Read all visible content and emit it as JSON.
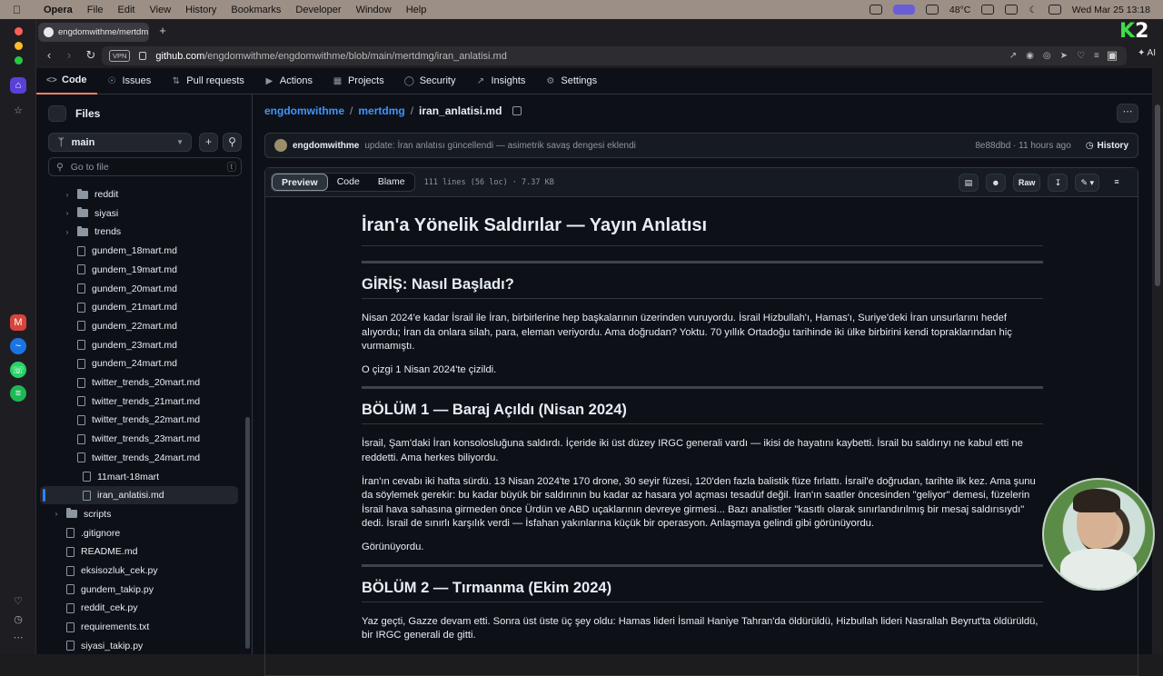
{
  "menubar": {
    "app": "Opera",
    "items": [
      "File",
      "Edit",
      "View",
      "History",
      "Bookmarks",
      "Developer",
      "Window",
      "Help"
    ],
    "temperature": "48°C",
    "datetime": "Wed Mar 25  13:18"
  },
  "browser": {
    "tab_title": "engdomwithme/mertdm",
    "url_host": "github.com",
    "url_path": "/engdomwithme/engdomwithme/blob/main/mertdmg/iran_anlatisi.md",
    "vpn_label": "VPN",
    "ai_label": "AI",
    "logo": "K2"
  },
  "repo_tabs": [
    {
      "icon": "code-icon",
      "label": "Code"
    },
    {
      "icon": "issues-icon",
      "label": "Issues"
    },
    {
      "icon": "pull-request-icon",
      "label": "Pull requests"
    },
    {
      "icon": "actions-icon",
      "label": "Actions"
    },
    {
      "icon": "projects-icon",
      "label": "Projects"
    },
    {
      "icon": "security-icon",
      "label": "Security"
    },
    {
      "icon": "insights-icon",
      "label": "Insights"
    },
    {
      "icon": "settings-icon",
      "label": "Settings"
    }
  ],
  "files": {
    "title": "Files",
    "branch": "main",
    "goto_placeholder": "Go to file",
    "goto_key": "t",
    "tree": [
      {
        "type": "folder",
        "name": "reddit",
        "depth": 1,
        "expandable": true
      },
      {
        "type": "folder",
        "name": "siyasi",
        "depth": 1,
        "expandable": true
      },
      {
        "type": "folder",
        "name": "trends",
        "depth": 1,
        "expandable": true
      },
      {
        "type": "file",
        "name": "gundem_18mart.md",
        "depth": 1
      },
      {
        "type": "file",
        "name": "gundem_19mart.md",
        "depth": 1
      },
      {
        "type": "file",
        "name": "gundem_20mart.md",
        "depth": 1
      },
      {
        "type": "file",
        "name": "gundem_21mart.md",
        "depth": 1
      },
      {
        "type": "file",
        "name": "gundem_22mart.md",
        "depth": 1
      },
      {
        "type": "file",
        "name": "gundem_23mart.md",
        "depth": 1
      },
      {
        "type": "file",
        "name": "gundem_24mart.md",
        "depth": 1
      },
      {
        "type": "file",
        "name": "twitter_trends_20mart.md",
        "depth": 1
      },
      {
        "type": "file",
        "name": "twitter_trends_21mart.md",
        "depth": 1
      },
      {
        "type": "file",
        "name": "twitter_trends_22mart.md",
        "depth": 1
      },
      {
        "type": "file",
        "name": "twitter_trends_23mart.md",
        "depth": 1
      },
      {
        "type": "file",
        "name": "twitter_trends_24mart.md",
        "depth": 1
      },
      {
        "type": "file",
        "name": "11mart-18mart",
        "depth": 0.5
      },
      {
        "type": "file",
        "name": "iran_anlatisi.md",
        "depth": 0.5,
        "selected": true
      },
      {
        "type": "folder",
        "name": "scripts",
        "depth": 0,
        "expandable": true
      },
      {
        "type": "file",
        "name": ".gitignore",
        "depth": 0
      },
      {
        "type": "file",
        "name": "README.md",
        "depth": 0
      },
      {
        "type": "file",
        "name": "eksisozluk_cek.py",
        "depth": 0
      },
      {
        "type": "file",
        "name": "gundem_takip.py",
        "depth": 0
      },
      {
        "type": "file",
        "name": "reddit_cek.py",
        "depth": 0
      },
      {
        "type": "file",
        "name": "requirements.txt",
        "depth": 0
      },
      {
        "type": "file",
        "name": "siyasi_takip.py",
        "depth": 0
      }
    ]
  },
  "breadcrumb": {
    "owner": "engdomwithme",
    "folder": "mertdmg",
    "file": "iran_anlatisi.md"
  },
  "commit": {
    "author": "engdomwithme",
    "message": "update: İran anlatısı güncellendi — asimetrik savaş dengesi eklendi",
    "meta": "8e88dbd · 11 hours ago",
    "history_label": "History"
  },
  "file_header": {
    "tabs": [
      "Preview",
      "Code",
      "Blame"
    ],
    "active_tab": "Preview",
    "info": "111 lines (56 loc) · 7.37 KB",
    "raw_label": "Raw"
  },
  "doc": {
    "title": "İran'a Yönelik Saldırılar — Yayın Anlatısı",
    "h_intro": "GİRİŞ: Nasıl Başladı?",
    "p_intro1": "Nisan 2024'e kadar İsrail ile İran, birbirlerine hep başkalarının üzerinden vuruyordu. İsrail Hizbullah'ı, Hamas'ı, Suriye'deki İran unsurlarını hedef alıyordu; İran da onlara silah, para, eleman veriyordu. Ama doğrudan? Yoktu. 70 yıllık Ortadoğu tarihinde iki ülke birbirini kendi topraklarından hiç vurmamıştı.",
    "p_intro2": "O çizgi 1 Nisan 2024'te çizildi.",
    "h_part1": "BÖLÜM 1 — Baraj Açıldı (Nisan 2024)",
    "p_part1a": "İsrail, Şam'daki İran konsolosluğuna saldırdı. İçeride iki üst düzey IRGC generali vardı — ikisi de hayatını kaybetti. İsrail bu saldırıyı ne kabul etti ne reddetti. Ama herkes biliyordu.",
    "p_part1b": "İran'ın cevabı iki hafta sürdü. 13 Nisan 2024'te 170 drone, 30 seyir füzesi, 120'den fazla balistik füze fırlattı. İsrail'e doğrudan, tarihte ilk kez. Ama şunu da söylemek gerekir: bu kadar büyük bir saldırının bu kadar az hasara yol açması tesadüf değil. İran'ın saatler öncesinden \"geliyor\" demesi, füzelerin İsrail hava sahasına girmeden önce Ürdün ve ABD uçaklarının devreye girmesi... Bazı analistler \"kasıtlı olarak sınırlandırılmış bir mesaj saldırısıydı\" dedi. İsrail de sınırlı karşılık verdi — İsfahan yakınlarına küçük bir operasyon. Anlaşmaya gelindi gibi görünüyordu.",
    "p_part1c": "Görünüyordu.",
    "h_part2": "BÖLÜM 2 — Tırmanma (Ekim 2024)",
    "p_part2a": "Yaz geçti, Gazze devam etti. Sonra üst üste üç şey oldu: Hamas lideri İsmail Haniye Tahran'da öldürüldü, Hizbullah lideri Nasrallah Beyrut'ta öldürüldü, bir IRGC generali de gitti."
  }
}
